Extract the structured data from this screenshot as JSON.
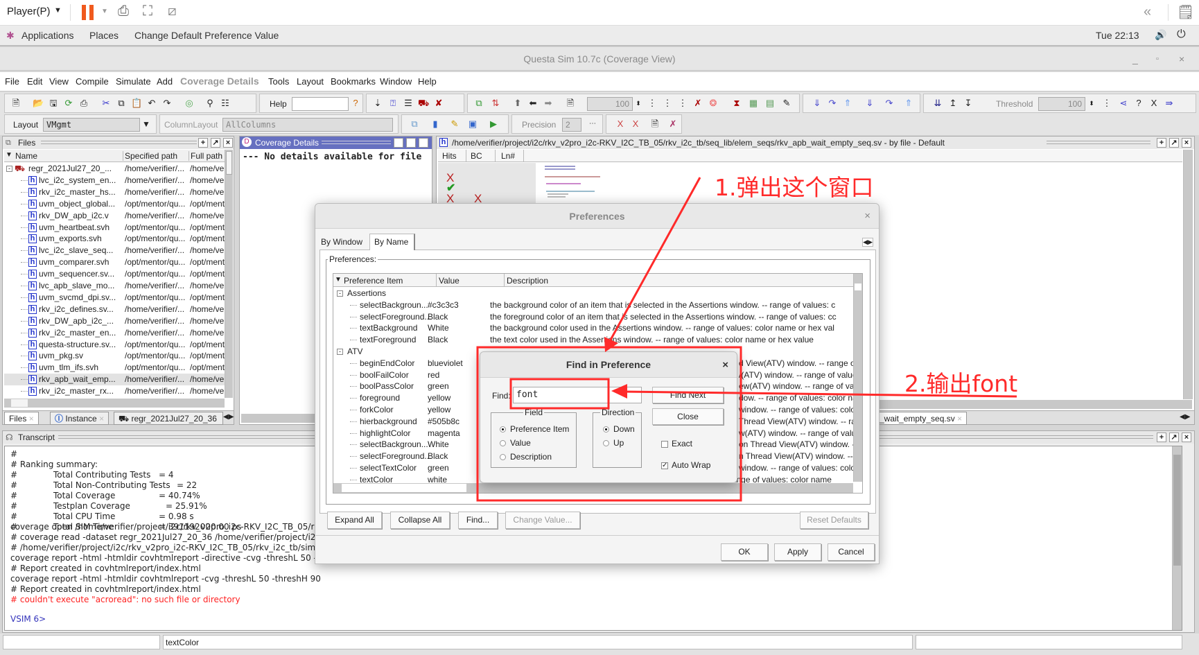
{
  "player": {
    "menu_label": "Player(P)",
    "pause_color": "#f05a1e"
  },
  "gnome": {
    "applications": "Applications",
    "places": "Places",
    "active_app": "Change Default Preference Value",
    "clock": "Tue 22:13"
  },
  "window": {
    "title": "Questa Sim 10.7c (Coverage View)"
  },
  "menu": [
    "File",
    "Edit",
    "View",
    "Compile",
    "Simulate",
    "Add",
    "Coverage Details",
    "Tools",
    "Layout",
    "Bookmarks",
    "Window",
    "Help"
  ],
  "toolbar": {
    "help_label": "Help",
    "help_value": "",
    "zoom_value": "100",
    "threshold_label": "Threshold",
    "threshold_value": "100",
    "layout_label": "Layout",
    "layout_value": "VMgmt",
    "column_layout_label": "ColumnLayout",
    "column_layout_value": "AllColumns",
    "precision_label": "Precision",
    "precision_value": "2"
  },
  "files_panel": {
    "title": "Files",
    "columns": [
      "Name",
      "Specified path",
      "Full path"
    ],
    "rows": [
      {
        "name": "regr_2021Jul27_20_...",
        "spec": "/home/verifier/...",
        "full": "/home/ve",
        "root": true
      },
      {
        "name": "lvc_i2c_system_en...",
        "spec": "/home/verifier/...",
        "full": "/home/ve"
      },
      {
        "name": "rkv_i2c_master_hs...",
        "spec": "/home/verifier/...",
        "full": "/home/ve"
      },
      {
        "name": "uvm_object_global...",
        "spec": "/opt/mentor/qu...",
        "full": "/opt/ment"
      },
      {
        "name": "rkv_DW_apb_i2c.v",
        "spec": "/home/verifier/...",
        "full": "/home/ve"
      },
      {
        "name": "uvm_heartbeat.svh",
        "spec": "/opt/mentor/qu...",
        "full": "/opt/ment"
      },
      {
        "name": "uvm_exports.svh",
        "spec": "/opt/mentor/qu...",
        "full": "/opt/ment"
      },
      {
        "name": "lvc_i2c_slave_seq...",
        "spec": "/home/verifier/...",
        "full": "/home/ve"
      },
      {
        "name": "uvm_comparer.svh",
        "spec": "/opt/mentor/qu...",
        "full": "/opt/ment"
      },
      {
        "name": "uvm_sequencer.sv...",
        "spec": "/opt/mentor/qu...",
        "full": "/opt/ment"
      },
      {
        "name": "lvc_apb_slave_mo...",
        "spec": "/home/verifier/...",
        "full": "/home/ve"
      },
      {
        "name": "uvm_svcmd_dpi.sv...",
        "spec": "/opt/mentor/qu...",
        "full": "/opt/ment"
      },
      {
        "name": "rkv_i2c_defines.sv...",
        "spec": "/home/verifier/...",
        "full": "/home/ve"
      },
      {
        "name": "rkv_DW_apb_i2c_...",
        "spec": "/home/verifier/...",
        "full": "/home/ve"
      },
      {
        "name": "rkv_i2c_master_en...",
        "spec": "/home/verifier/...",
        "full": "/home/ve"
      },
      {
        "name": "questa-structure.sv...",
        "spec": "/opt/mentor/qu...",
        "full": "/opt/ment"
      },
      {
        "name": "uvm_pkg.sv",
        "spec": "/opt/mentor/qu...",
        "full": "/opt/ment"
      },
      {
        "name": "uvm_tlm_ifs.svh",
        "spec": "/opt/mentor/qu...",
        "full": "/opt/ment"
      },
      {
        "name": "rkv_apb_wait_emp...",
        "spec": "/home/verifier/...",
        "full": "/home/ve",
        "selected": true
      },
      {
        "name": "rkv_i2c_master_rx...",
        "spec": "/home/verifier/...",
        "full": "/home/ve"
      }
    ],
    "tabs": [
      "Files",
      "Instance",
      "regr_2021Jul27_20_36"
    ]
  },
  "coverage_details": {
    "title": "Coverage Details",
    "message": "--- No details available for file "
  },
  "source_panel": {
    "title": "/home/verifier/project/i2c/rkv_v2pro_i2c-RKV_I2C_TB_05/rkv_i2c_tb/seq_lib/elem_seqs/rkv_apb_wait_empty_seq.sv - by file - Default",
    "columns": [
      "Hits",
      "BC",
      "Ln#"
    ],
    "tab": "_wait_empty_seq.sv",
    "marks": [
      "X",
      "✔",
      "X",
      "X"
    ]
  },
  "transcript": {
    "title": "Transcript",
    "lines": [
      "#",
      "# Ranking summary:"
    ],
    "ranking": [
      {
        "label": "Total Contributing Tests",
        "value": "= 4"
      },
      {
        "label": "Total Non-Contributing Tests",
        "value": "= 22"
      },
      {
        "label": "Total Coverage",
        "value": "= 40.74%"
      },
      {
        "label": "Testplan Coverage",
        "value": "= 25.91%"
      },
      {
        "label": "Total CPU Time",
        "value": "= 0.98 s"
      },
      {
        "label": "Total SIM Time",
        "value": "= 391192000.00 ps"
      }
    ],
    "after": [
      "coverage open /home/verifier/project/i2c/rkv_v2pro_i2c-RKV_I2C_TB_05/rkv",
      "# coverage read -dataset regr_2021Jul27_20_36 /home/verifier/project/i2c/",
      "# /home/verifier/project/i2c/rkv_v2pro_i2c-RKV_I2C_TB_05/rkv_i2c_tb/sim/r",
      "coverage report -html -htmldir covhtmlreport -directive -cvg -threshL 50 -threshH 90",
      "# Report created in covhtmlreport/index.html",
      "coverage report -html -htmldir covhtmlreport -cvg -threshL 50 -threshH 90",
      "# Report created in covhtmlreport/index.html"
    ],
    "error": "# couldn't execute \"acroread\": no such file or directory",
    "prompt": "VSIM 6>",
    "error_color": "#ff2222",
    "prompt_color": "#3333bb"
  },
  "statusbar": {
    "left": "",
    "middle": "textColor",
    "right": ""
  },
  "preferences": {
    "title": "Preferences",
    "tabs": [
      "By Window",
      "By Name"
    ],
    "active_tab": "By Name",
    "group_label": "Preferences:",
    "columns": [
      "Preference Item",
      "Value",
      "Description"
    ],
    "groups": [
      {
        "name": "Assertions",
        "items": [
          {
            "item": "selectBackgroun...",
            "value": "#c3c3c3",
            "desc": "the background color of an item that is selected in the Assertions window. -- range of values: c"
          },
          {
            "item": "selectForeground...",
            "value": "Black",
            "desc": "the foreground color of an item that is selected in the Assertions window. -- range of values: cc"
          },
          {
            "item": "textBackground",
            "value": "White",
            "desc": "the background color used in the Assertions window. -- range of values: color name or hex val"
          },
          {
            "item": "textForeground",
            "value": "Black",
            "desc": "the text color used in the Assertions window. -- range of values: color name or hex value"
          }
        ]
      },
      {
        "name": "ATV",
        "items": [
          {
            "item": "beginEndColor",
            "value": "blueviolet",
            "desc": "d View(ATV) window. -- range of"
          },
          {
            "item": "boolFailColor",
            "value": "red",
            "desc": "/(ATV) window. -- range of values"
          },
          {
            "item": "boolPassColor",
            "value": "green",
            "desc": "ew(ATV) window. -- range of valu"
          },
          {
            "item": "foreground",
            "value": "yellow",
            "desc": "dow. -- range of values: color nar"
          },
          {
            "item": "forkColor",
            "value": "yellow",
            "desc": "window. -- range of values: color r"
          },
          {
            "item": "hierbackground",
            "value": "#505b8c",
            "desc": "Thread View(ATV) window. -- ra"
          },
          {
            "item": "highlightColor",
            "value": "magenta",
            "desc": "w(ATV) window. -- range of value"
          },
          {
            "item": "selectBackgroun...",
            "value": "White",
            "desc": "on Thread View(ATV) window. --"
          },
          {
            "item": "selectForeground...",
            "value": "Black",
            "desc": "n Thread View(ATV) window. -- r"
          },
          {
            "item": "selectTextColor",
            "value": "green",
            "desc": "window. -- range of values: color"
          },
          {
            "item": "textColor",
            "value": "white",
            "desc": "the text color used in the Assertion Thread View(ATV) window. -- range of values: color name"
          }
        ]
      }
    ],
    "buttons": {
      "expand_all": "Expand All",
      "collapse_all": "Collapse All",
      "find": "Find...",
      "change_value": "Change Value...",
      "reset_defaults": "Reset Defaults",
      "ok": "OK",
      "apply": "Apply",
      "cancel": "Cancel"
    }
  },
  "find_dialog": {
    "title": "Find in Preference",
    "find_label": "Find:",
    "find_value": "font",
    "find_next": "Find Next",
    "close": "Close",
    "field_label": "Field",
    "field_options": [
      "Preference Item",
      "Value",
      "Description"
    ],
    "field_selected": "Preference Item",
    "direction_label": "Direction",
    "direction_options": [
      "Down",
      "Up"
    ],
    "direction_selected": "Down",
    "exact_label": "Exact",
    "exact_checked": false,
    "autowrap_label": "Auto Wrap",
    "autowrap_checked": true
  },
  "annotations": {
    "step1": "1.弹出这个窗口",
    "step2": "2.输出font",
    "color": "#ff2a2a"
  }
}
